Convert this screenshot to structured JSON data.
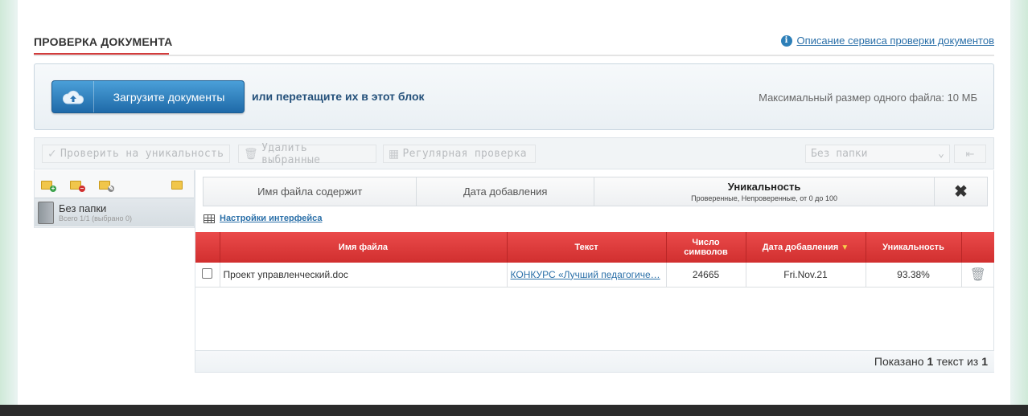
{
  "header": {
    "title": "ПРОВЕРКА ДОКУМЕНТА",
    "help_link": "Описание сервиса проверки документов"
  },
  "upload": {
    "button_label": "Загрузите документы",
    "or_text": "или перетащите их в этот блок",
    "max_size": "Максимальный размер одного файла: 10 МБ"
  },
  "toolbar": {
    "check": "Проверить на уникальность",
    "delete": "Удалить выбранные",
    "regular": "Регулярная проверка",
    "folder_select": "Без папки"
  },
  "folders": {
    "name": "Без папки",
    "sub": "Всего 1/1 (выбрано 0)"
  },
  "filters": {
    "filename": "Имя файла содержит",
    "date": "Дата добавления",
    "uniq_title": "Уникальность",
    "uniq_sub": "Проверенные, Непроверенные, от 0 до 100"
  },
  "settings_link": "Настройки интерфейса",
  "table": {
    "headers": {
      "filename": "Имя файла",
      "text": "Текст",
      "chars_1": "Число",
      "chars_2": "символов",
      "date": "Дата добавления",
      "uniq": "Уникальность"
    },
    "rows": [
      {
        "filename": "Проект управленческий.doc",
        "text": "КОНКУРС «Лучший педагогиче…",
        "chars": "24665",
        "date": "Fri.Nov.21",
        "uniq": "93.38%"
      }
    ]
  },
  "footer": {
    "prefix": "Показано",
    "shown": "1",
    "middle": "текст из",
    "total": "1"
  },
  "colors": {
    "accent_red": "#d12f2f",
    "link_blue": "#2a6fa8",
    "success_green": "#3bb54a"
  }
}
